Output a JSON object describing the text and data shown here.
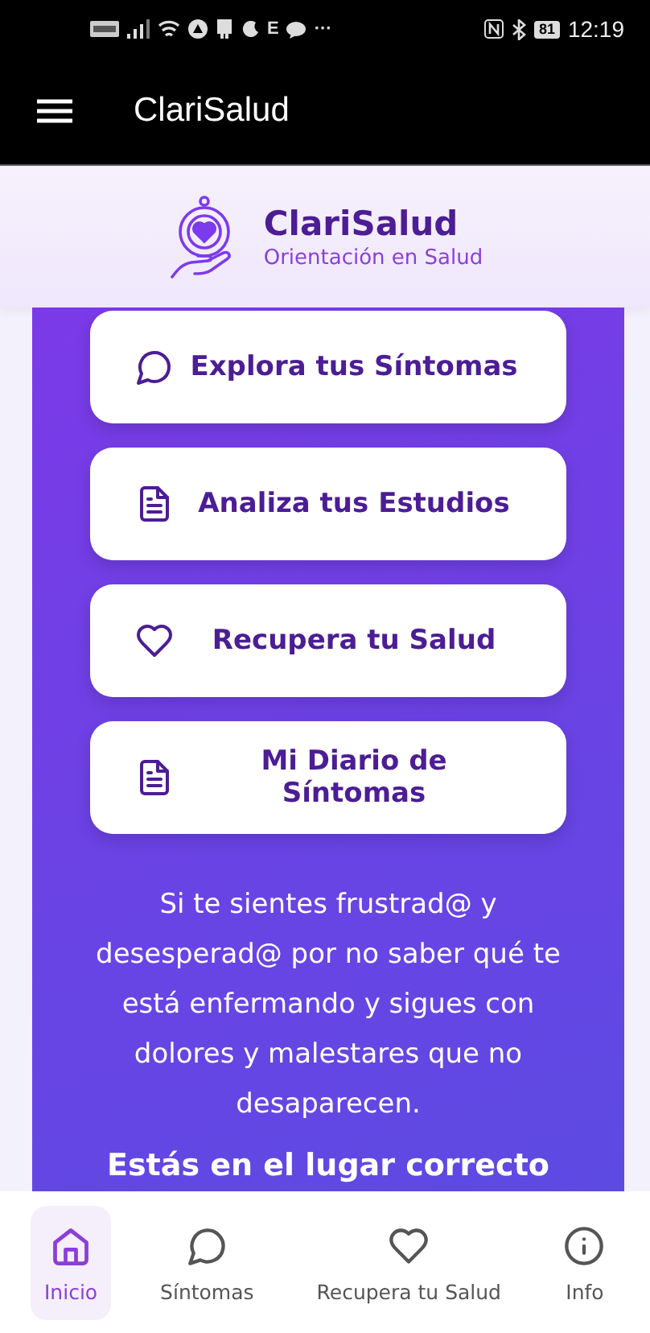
{
  "status_bar": {
    "network_type": "E",
    "more": "···",
    "battery": "81",
    "time": "12:19"
  },
  "app_bar": {
    "title": "ClariSalud"
  },
  "header": {
    "title": "ClariSalud",
    "subtitle": "Orientación en Salud"
  },
  "actions": [
    {
      "label": "Explora tus Síntomas",
      "kind": "chat"
    },
    {
      "label": "Analiza tus Estudios",
      "kind": "document"
    },
    {
      "label": "Recupera tu Salud",
      "kind": "heart"
    },
    {
      "label": "Mi Diario de Síntomas",
      "kind": "document"
    }
  ],
  "intro": "Si te sientes frustrad@ y desesperad@ por no saber qué te está enfermando y sigues con dolores y malestares que no desaparecen.",
  "tagline": "Estás en el lugar correcto",
  "bottom_nav": [
    {
      "label": "Inicio",
      "kind": "home",
      "selected": true
    },
    {
      "label": "Síntomas",
      "kind": "chat",
      "selected": false
    },
    {
      "label": "Recupera tu Salud",
      "kind": "heart",
      "selected": false
    },
    {
      "label": "Info",
      "kind": "info",
      "selected": false
    }
  ]
}
